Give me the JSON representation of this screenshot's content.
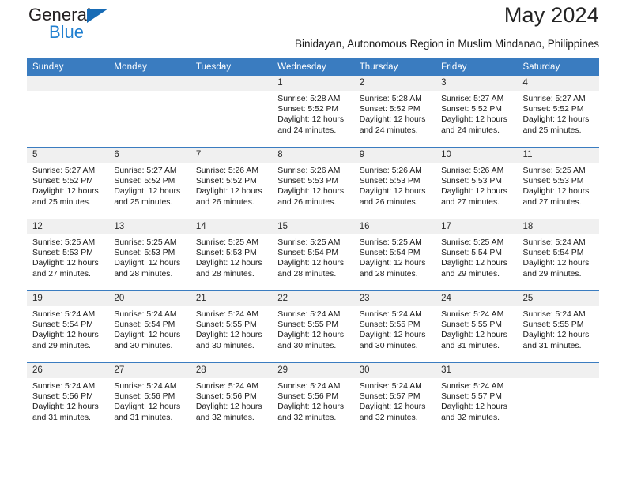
{
  "logo": {
    "primary_text": "General",
    "secondary_text": "Blue",
    "triangle_icon": "triangle-icon",
    "brand_blue": "#1f7fd0",
    "triangle_blue": "#176bb5"
  },
  "header": {
    "month_title": "May 2024",
    "location_subtitle": "Binidayan, Autonomous Region in Muslim Mindanao, Philippines"
  },
  "colors": {
    "header_row_bg": "#3a7cc0",
    "header_row_text": "#ffffff",
    "daynum_strip_bg": "#f0f0f0",
    "row_divider": "#3a7cc0",
    "body_text": "#1a1a1a"
  },
  "weekday_headers": [
    "Sunday",
    "Monday",
    "Tuesday",
    "Wednesday",
    "Thursday",
    "Friday",
    "Saturday"
  ],
  "weeks": [
    [
      {
        "day": "",
        "empty": true,
        "sunrise": "",
        "sunset": "",
        "daylight_line1": "",
        "daylight_line2": ""
      },
      {
        "day": "",
        "empty": true,
        "sunrise": "",
        "sunset": "",
        "daylight_line1": "",
        "daylight_line2": ""
      },
      {
        "day": "",
        "empty": true,
        "sunrise": "",
        "sunset": "",
        "daylight_line1": "",
        "daylight_line2": ""
      },
      {
        "day": "1",
        "empty": false,
        "sunrise": "Sunrise: 5:28 AM",
        "sunset": "Sunset: 5:52 PM",
        "daylight_line1": "Daylight: 12 hours",
        "daylight_line2": "and 24 minutes."
      },
      {
        "day": "2",
        "empty": false,
        "sunrise": "Sunrise: 5:28 AM",
        "sunset": "Sunset: 5:52 PM",
        "daylight_line1": "Daylight: 12 hours",
        "daylight_line2": "and 24 minutes."
      },
      {
        "day": "3",
        "empty": false,
        "sunrise": "Sunrise: 5:27 AM",
        "sunset": "Sunset: 5:52 PM",
        "daylight_line1": "Daylight: 12 hours",
        "daylight_line2": "and 24 minutes."
      },
      {
        "day": "4",
        "empty": false,
        "sunrise": "Sunrise: 5:27 AM",
        "sunset": "Sunset: 5:52 PM",
        "daylight_line1": "Daylight: 12 hours",
        "daylight_line2": "and 25 minutes."
      }
    ],
    [
      {
        "day": "5",
        "empty": false,
        "sunrise": "Sunrise: 5:27 AM",
        "sunset": "Sunset: 5:52 PM",
        "daylight_line1": "Daylight: 12 hours",
        "daylight_line2": "and 25 minutes."
      },
      {
        "day": "6",
        "empty": false,
        "sunrise": "Sunrise: 5:27 AM",
        "sunset": "Sunset: 5:52 PM",
        "daylight_line1": "Daylight: 12 hours",
        "daylight_line2": "and 25 minutes."
      },
      {
        "day": "7",
        "empty": false,
        "sunrise": "Sunrise: 5:26 AM",
        "sunset": "Sunset: 5:52 PM",
        "daylight_line1": "Daylight: 12 hours",
        "daylight_line2": "and 26 minutes."
      },
      {
        "day": "8",
        "empty": false,
        "sunrise": "Sunrise: 5:26 AM",
        "sunset": "Sunset: 5:53 PM",
        "daylight_line1": "Daylight: 12 hours",
        "daylight_line2": "and 26 minutes."
      },
      {
        "day": "9",
        "empty": false,
        "sunrise": "Sunrise: 5:26 AM",
        "sunset": "Sunset: 5:53 PM",
        "daylight_line1": "Daylight: 12 hours",
        "daylight_line2": "and 26 minutes."
      },
      {
        "day": "10",
        "empty": false,
        "sunrise": "Sunrise: 5:26 AM",
        "sunset": "Sunset: 5:53 PM",
        "daylight_line1": "Daylight: 12 hours",
        "daylight_line2": "and 27 minutes."
      },
      {
        "day": "11",
        "empty": false,
        "sunrise": "Sunrise: 5:25 AM",
        "sunset": "Sunset: 5:53 PM",
        "daylight_line1": "Daylight: 12 hours",
        "daylight_line2": "and 27 minutes."
      }
    ],
    [
      {
        "day": "12",
        "empty": false,
        "sunrise": "Sunrise: 5:25 AM",
        "sunset": "Sunset: 5:53 PM",
        "daylight_line1": "Daylight: 12 hours",
        "daylight_line2": "and 27 minutes."
      },
      {
        "day": "13",
        "empty": false,
        "sunrise": "Sunrise: 5:25 AM",
        "sunset": "Sunset: 5:53 PM",
        "daylight_line1": "Daylight: 12 hours",
        "daylight_line2": "and 28 minutes."
      },
      {
        "day": "14",
        "empty": false,
        "sunrise": "Sunrise: 5:25 AM",
        "sunset": "Sunset: 5:53 PM",
        "daylight_line1": "Daylight: 12 hours",
        "daylight_line2": "and 28 minutes."
      },
      {
        "day": "15",
        "empty": false,
        "sunrise": "Sunrise: 5:25 AM",
        "sunset": "Sunset: 5:54 PM",
        "daylight_line1": "Daylight: 12 hours",
        "daylight_line2": "and 28 minutes."
      },
      {
        "day": "16",
        "empty": false,
        "sunrise": "Sunrise: 5:25 AM",
        "sunset": "Sunset: 5:54 PM",
        "daylight_line1": "Daylight: 12 hours",
        "daylight_line2": "and 28 minutes."
      },
      {
        "day": "17",
        "empty": false,
        "sunrise": "Sunrise: 5:25 AM",
        "sunset": "Sunset: 5:54 PM",
        "daylight_line1": "Daylight: 12 hours",
        "daylight_line2": "and 29 minutes."
      },
      {
        "day": "18",
        "empty": false,
        "sunrise": "Sunrise: 5:24 AM",
        "sunset": "Sunset: 5:54 PM",
        "daylight_line1": "Daylight: 12 hours",
        "daylight_line2": "and 29 minutes."
      }
    ],
    [
      {
        "day": "19",
        "empty": false,
        "sunrise": "Sunrise: 5:24 AM",
        "sunset": "Sunset: 5:54 PM",
        "daylight_line1": "Daylight: 12 hours",
        "daylight_line2": "and 29 minutes."
      },
      {
        "day": "20",
        "empty": false,
        "sunrise": "Sunrise: 5:24 AM",
        "sunset": "Sunset: 5:54 PM",
        "daylight_line1": "Daylight: 12 hours",
        "daylight_line2": "and 30 minutes."
      },
      {
        "day": "21",
        "empty": false,
        "sunrise": "Sunrise: 5:24 AM",
        "sunset": "Sunset: 5:55 PM",
        "daylight_line1": "Daylight: 12 hours",
        "daylight_line2": "and 30 minutes."
      },
      {
        "day": "22",
        "empty": false,
        "sunrise": "Sunrise: 5:24 AM",
        "sunset": "Sunset: 5:55 PM",
        "daylight_line1": "Daylight: 12 hours",
        "daylight_line2": "and 30 minutes."
      },
      {
        "day": "23",
        "empty": false,
        "sunrise": "Sunrise: 5:24 AM",
        "sunset": "Sunset: 5:55 PM",
        "daylight_line1": "Daylight: 12 hours",
        "daylight_line2": "and 30 minutes."
      },
      {
        "day": "24",
        "empty": false,
        "sunrise": "Sunrise: 5:24 AM",
        "sunset": "Sunset: 5:55 PM",
        "daylight_line1": "Daylight: 12 hours",
        "daylight_line2": "and 31 minutes."
      },
      {
        "day": "25",
        "empty": false,
        "sunrise": "Sunrise: 5:24 AM",
        "sunset": "Sunset: 5:55 PM",
        "daylight_line1": "Daylight: 12 hours",
        "daylight_line2": "and 31 minutes."
      }
    ],
    [
      {
        "day": "26",
        "empty": false,
        "sunrise": "Sunrise: 5:24 AM",
        "sunset": "Sunset: 5:56 PM",
        "daylight_line1": "Daylight: 12 hours",
        "daylight_line2": "and 31 minutes."
      },
      {
        "day": "27",
        "empty": false,
        "sunrise": "Sunrise: 5:24 AM",
        "sunset": "Sunset: 5:56 PM",
        "daylight_line1": "Daylight: 12 hours",
        "daylight_line2": "and 31 minutes."
      },
      {
        "day": "28",
        "empty": false,
        "sunrise": "Sunrise: 5:24 AM",
        "sunset": "Sunset: 5:56 PM",
        "daylight_line1": "Daylight: 12 hours",
        "daylight_line2": "and 32 minutes."
      },
      {
        "day": "29",
        "empty": false,
        "sunrise": "Sunrise: 5:24 AM",
        "sunset": "Sunset: 5:56 PM",
        "daylight_line1": "Daylight: 12 hours",
        "daylight_line2": "and 32 minutes."
      },
      {
        "day": "30",
        "empty": false,
        "sunrise": "Sunrise: 5:24 AM",
        "sunset": "Sunset: 5:57 PM",
        "daylight_line1": "Daylight: 12 hours",
        "daylight_line2": "and 32 minutes."
      },
      {
        "day": "31",
        "empty": false,
        "sunrise": "Sunrise: 5:24 AM",
        "sunset": "Sunset: 5:57 PM",
        "daylight_line1": "Daylight: 12 hours",
        "daylight_line2": "and 32 minutes."
      },
      {
        "day": "",
        "empty": true,
        "sunrise": "",
        "sunset": "",
        "daylight_line1": "",
        "daylight_line2": ""
      }
    ]
  ]
}
